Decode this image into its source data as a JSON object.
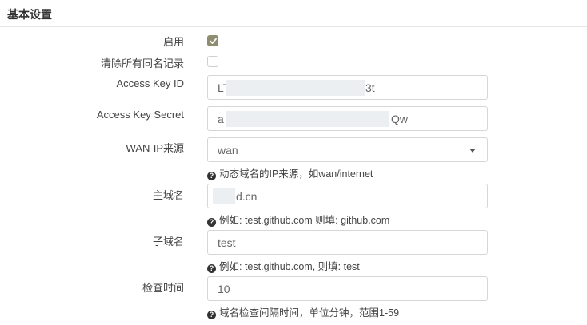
{
  "section": {
    "title": "基本设置"
  },
  "fields": {
    "enable": {
      "label": "启用",
      "checked": true
    },
    "clear_same_name": {
      "label": "清除所有同名记录",
      "checked": false
    },
    "access_key_id": {
      "label": "Access Key ID",
      "value_start": "LT",
      "value_end": "3t"
    },
    "access_key_secret": {
      "label": "Access Key Secret",
      "value_start": "a",
      "value_end": "Qw"
    },
    "wan_ip_source": {
      "label": "WAN-IP来源",
      "value": "wan",
      "help": "动态域名的IP来源，如wan/internet"
    },
    "main_domain": {
      "label": "主域名",
      "value_end": "d.cn",
      "help": "例如: test.github.com 则填: github.com"
    },
    "sub_domain": {
      "label": "子域名",
      "value": "test",
      "help": "例如: test.github.com, 则填: test"
    },
    "check_interval": {
      "label": "检查时间",
      "value": "10",
      "help": "域名检查间隔时间，单位分钟，范围1-59"
    }
  },
  "icons": {
    "help": "question-circle-icon",
    "check": "checkmark-icon",
    "caret": "caret-down-icon"
  },
  "colors": {
    "checkbox_checked": "#8f8d6f",
    "border": "#d6d6d6"
  }
}
